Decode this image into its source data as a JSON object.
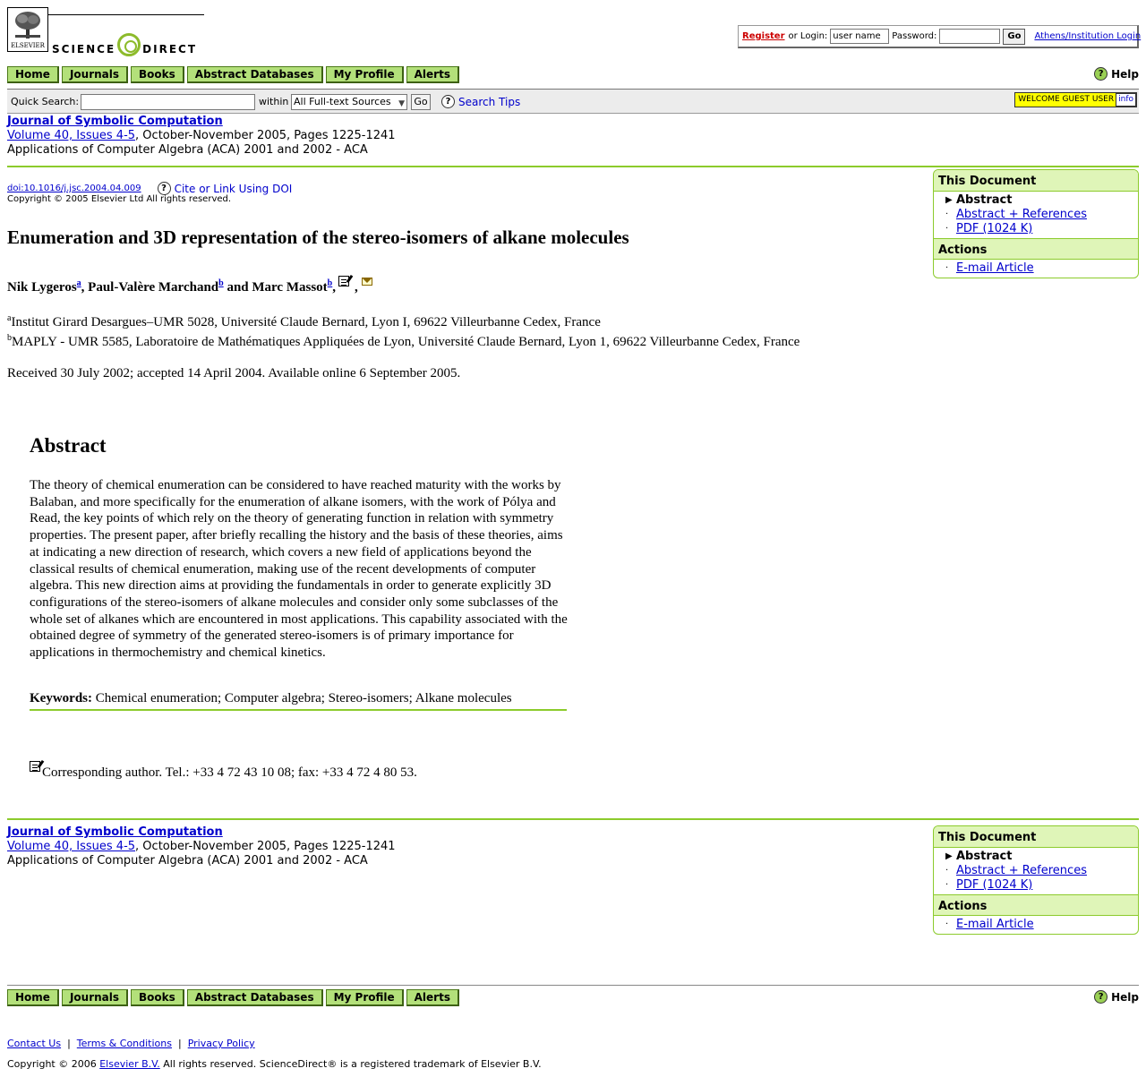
{
  "header": {
    "logo_text": "ELSEVIER",
    "brand_left": "SCIENCE",
    "brand_right": "DIRECT",
    "login": {
      "register": "Register",
      "or_login": "or Login:",
      "username_value": "user name",
      "password_label": "Password:",
      "go": "Go",
      "athens": "Athens/Institution Login"
    }
  },
  "nav": {
    "items": [
      "Home",
      "Journals",
      "Books",
      "Abstract Databases",
      "My Profile",
      "Alerts"
    ],
    "help": "Help"
  },
  "search": {
    "label": "Quick Search:",
    "within": "within",
    "source": "All Full-text Sources",
    "go": "Go",
    "tips": "Search Tips",
    "welcome": "WELCOME GUEST USER",
    "info": "info"
  },
  "journal": {
    "title": "Journal of Symbolic Computation",
    "volume": "Volume 40, Issues 4-5",
    "date_pages": ", October-November 2005, Pages 1225-1241",
    "special_issue": "Applications of Computer Algebra (ACA) 2001 and 2002 - ACA"
  },
  "sidebar": {
    "doc_heading": "This Document",
    "doc_items": [
      "Abstract",
      "Abstract + References",
      "PDF (1024 K)"
    ],
    "actions_heading": "Actions",
    "action_items": [
      "E-mail Article"
    ]
  },
  "article": {
    "doi": "doi:10.1016/j.jsc.2004.04.009",
    "cite": "Cite or Link Using DOI",
    "copyright": "Copyright © 2005 Elsevier Ltd All rights reserved.",
    "title": "Enumeration and 3D representation of the stereo-isomers of alkane molecules",
    "authors": {
      "a1": "Nik Lygeros",
      "a1_sup": "a",
      "a2": ", Paul-Valère Marchand",
      "a2_sup": "b",
      "a3": " and Marc Massot",
      "a3_sup": "b",
      "sep": ","
    },
    "affiliations": {
      "a_sup": "a",
      "a": "Institut Girard Desargues–UMR 5028, Université Claude Bernard, Lyon I, 69622 Villeurbanne Cedex, France",
      "b_sup": "b",
      "b": "MAPLY - UMR 5585, Laboratoire de Mathématiques Appliquées de Lyon, Université Claude Bernard, Lyon 1, 69622 Villeurbanne Cedex, France"
    },
    "dates": "Received 30 July 2002;  accepted 14 April 2004.  Available online 6 September 2005.",
    "abstract_heading": "Abstract",
    "abstract": "The theory of chemical enumeration can be considered to have reached maturity with the works by Balaban, and more specifically for the enumeration of alkane isomers, with the work of Pólya and Read, the key points of which rely on the theory of generating function in relation with symmetry properties. The present paper, after briefly recalling the history and the basis of these theories, aims at indicating a new direction of research, which covers a new field of applications beyond the classical results of chemical enumeration, making use of the recent developments of computer algebra. This new direction aims at providing the fundamentals in order to generate explicitly 3D configurations of the stereo-isomers of alkane molecules and consider only some subclasses of the whole set of alkanes which are encountered in most applications. This capability associated with the obtained degree of symmetry of the generated stereo-isomers is of primary importance for applications in thermochemistry and chemical kinetics.",
    "keywords_label": "Keywords:",
    "keywords": " Chemical enumeration; Computer algebra; Stereo-isomers; Alkane molecules",
    "corresponding": "Corresponding author. Tel.: +33 4 72 43 10 08; fax: +33 4 72 4 80 53."
  },
  "footer": {
    "links": [
      "Contact Us",
      "Terms & Conditions",
      "Privacy Policy"
    ],
    "copy_pre": "Copyright © 2006 ",
    "copy_link": "Elsevier B.V.",
    "copy_post": " All rights reserved. ScienceDirect® is a registered trademark of Elsevier B.V."
  }
}
